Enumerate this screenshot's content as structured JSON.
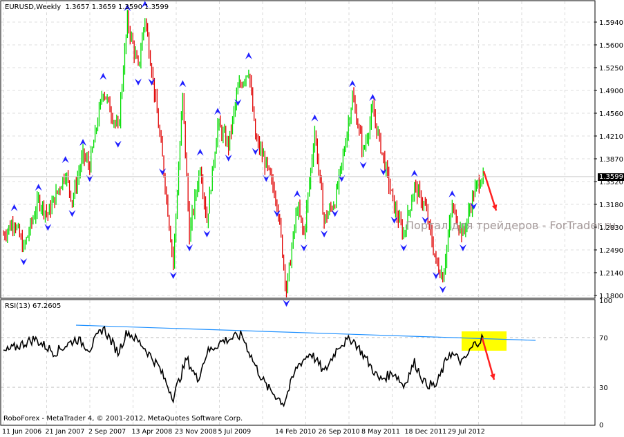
{
  "chart_data": {
    "type": "ohlc",
    "title": "EURUSD,Weekly",
    "ohlc_readout": {
      "open": "1.3657",
      "high": "1.3659",
      "low": "1.3590",
      "close": "1.3599"
    },
    "current_price": "1.3599",
    "price_ticks": [
      "1.5940",
      "1.5600",
      "1.5250",
      "1.4900",
      "1.4560",
      "1.4210",
      "1.3870",
      "1.3520",
      "1.3180",
      "1.2830",
      "1.2490",
      "1.2140",
      "1.1800"
    ],
    "ylim": [
      1.18,
      1.594
    ],
    "date_ticks": [
      "11 Jun 2006",
      "21 Jan 2007",
      "2 Sep 2007",
      "13 Apr 2008",
      "23 Nov 2008",
      "5 Jul 2009",
      "14 Feb 2010",
      "26 Sep 2010",
      "8 May 2011",
      "18 Dec 2011",
      "29 Jul 2012"
    ],
    "price_path_weeks": [
      0,
      8,
      15,
      26,
      33,
      46,
      51,
      59,
      64,
      74,
      85,
      92,
      100,
      105,
      110,
      118,
      126,
      133,
      138,
      146,
      151,
      159,
      167,
      174,
      182,
      187,
      195,
      203,
      210,
      218,
      223,
      231,
      238,
      246,
      251,
      259,
      267,
      274,
      282,
      290,
      297,
      305,
      313,
      321,
      326,
      333,
      341,
      349,
      356
    ],
    "price_path_close": [
      1.272,
      1.293,
      1.251,
      1.324,
      1.303,
      1.366,
      1.324,
      1.392,
      1.377,
      1.492,
      1.429,
      1.596,
      1.523,
      1.601,
      1.523,
      1.387,
      1.23,
      1.481,
      1.272,
      1.377,
      1.293,
      1.439,
      1.408,
      1.492,
      1.523,
      1.418,
      1.377,
      1.324,
      1.188,
      1.314,
      1.272,
      1.429,
      1.293,
      1.324,
      1.377,
      1.481,
      1.397,
      1.46,
      1.387,
      1.314,
      1.272,
      1.345,
      1.314,
      1.23,
      1.209,
      1.314,
      1.272,
      1.335,
      1.366
    ],
    "rsi": {
      "label": "RSI(13) 67.2605",
      "ticks": [
        "100",
        "70",
        "30",
        "0"
      ],
      "levels": [
        70,
        30
      ],
      "weeks": [
        0,
        23,
        38,
        54,
        64,
        74,
        85,
        92,
        103,
        115,
        126,
        136,
        144,
        151,
        162,
        177,
        187,
        195,
        208,
        218,
        228,
        238,
        249,
        259,
        269,
        279,
        290,
        297,
        305,
        313,
        321,
        331,
        341,
        349,
        356
      ],
      "values": [
        58,
        69,
        58,
        69,
        61,
        78,
        58,
        75,
        64,
        47,
        22,
        53,
        36,
        58,
        67,
        72,
        47,
        31,
        17,
        47,
        58,
        42,
        64,
        69,
        53,
        36,
        42,
        31,
        50,
        33,
        31,
        58,
        50,
        64,
        70
      ]
    },
    "annotations": {
      "watermark": "Портал для трейдеров - ForTrader.ru"
    }
  },
  "footer": {
    "copyright": "RoboForex - MetaTrader 4, © 2001-2012, MetaQuotes Software Corp."
  },
  "colors": {
    "up": "#00dd00",
    "down": "#e00000",
    "fractal": "#2020ff",
    "trendline": "#1e90ff",
    "highlight": "#ffff00",
    "arrow": "#ff2020"
  }
}
